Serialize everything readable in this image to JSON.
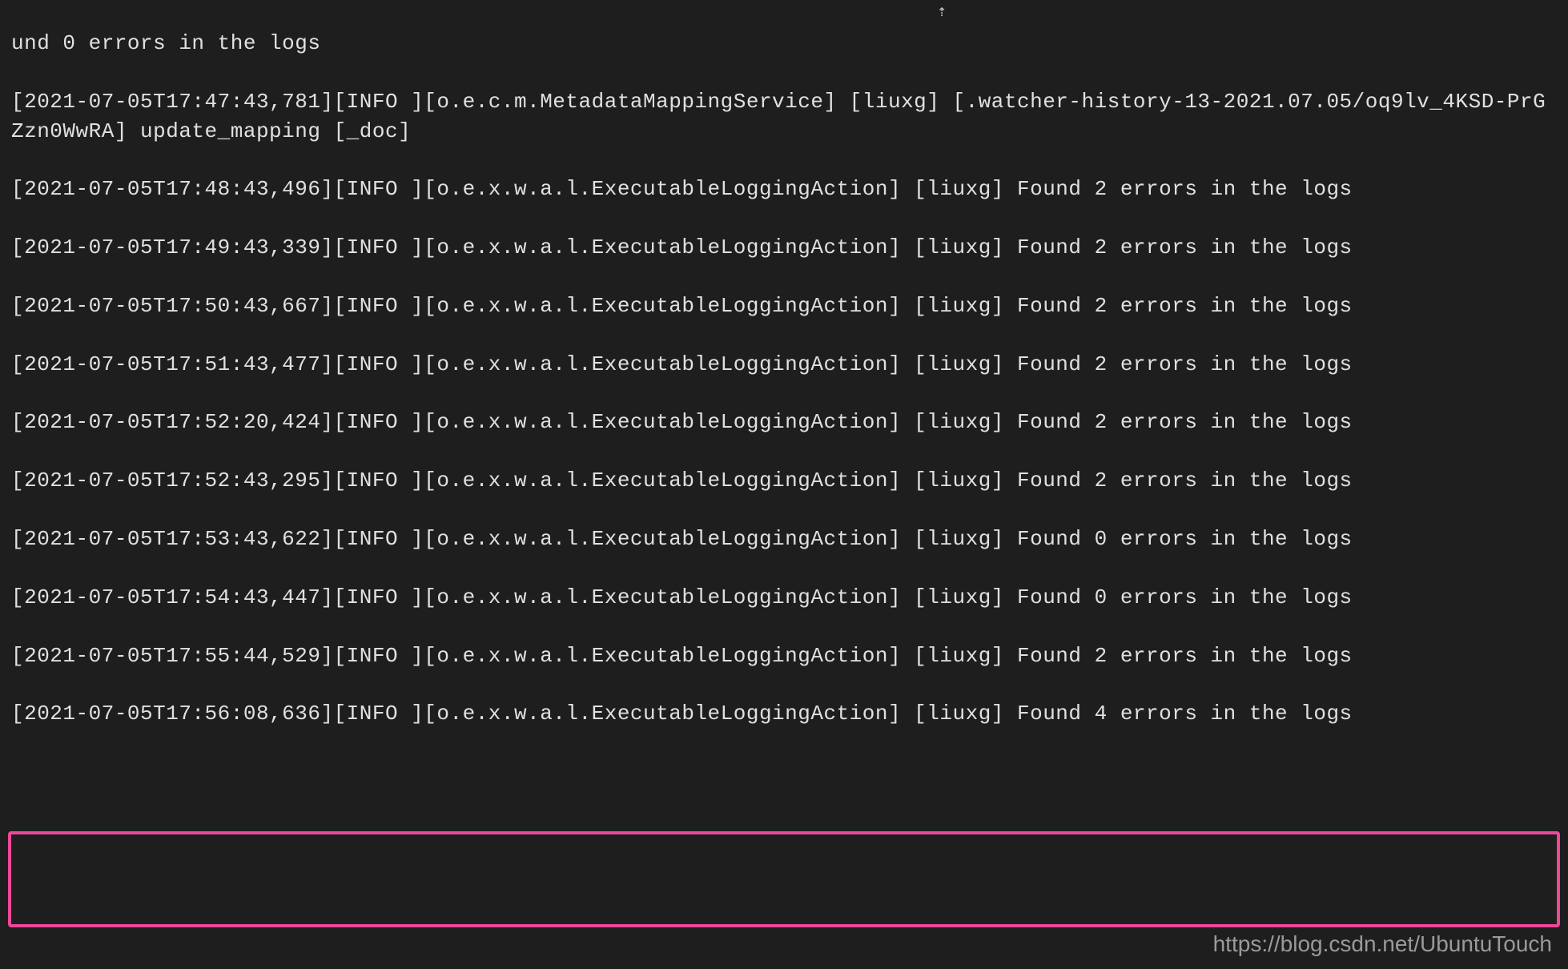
{
  "terminal": {
    "lines": [
      "und 0 errors in the logs",
      "[2021-07-05T17:47:43,781][INFO ][o.e.c.m.MetadataMappingService] [liuxg] [.watcher-history-13-2021.07.05/oq9lv_4KSD-PrGZzn0WwRA] update_mapping [_doc]",
      "[2021-07-05T17:48:43,496][INFO ][o.e.x.w.a.l.ExecutableLoggingAction] [liuxg] Found 2 errors in the logs",
      "[2021-07-05T17:49:43,339][INFO ][o.e.x.w.a.l.ExecutableLoggingAction] [liuxg] Found 2 errors in the logs",
      "[2021-07-05T17:50:43,667][INFO ][o.e.x.w.a.l.ExecutableLoggingAction] [liuxg] Found 2 errors in the logs",
      "[2021-07-05T17:51:43,477][INFO ][o.e.x.w.a.l.ExecutableLoggingAction] [liuxg] Found 2 errors in the logs",
      "[2021-07-05T17:52:20,424][INFO ][o.e.x.w.a.l.ExecutableLoggingAction] [liuxg] Found 2 errors in the logs",
      "[2021-07-05T17:52:43,295][INFO ][o.e.x.w.a.l.ExecutableLoggingAction] [liuxg] Found 2 errors in the logs",
      "[2021-07-05T17:53:43,622][INFO ][o.e.x.w.a.l.ExecutableLoggingAction] [liuxg] Found 0 errors in the logs",
      "[2021-07-05T17:54:43,447][INFO ][o.e.x.w.a.l.ExecutableLoggingAction] [liuxg] Found 0 errors in the logs",
      "[2021-07-05T17:55:44,529][INFO ][o.e.x.w.a.l.ExecutableLoggingAction] [liuxg] Found 2 errors in the logs",
      "[2021-07-05T17:56:08,636][INFO ][o.e.x.w.a.l.ExecutableLoggingAction] [liuxg] Found 4 errors in the logs"
    ]
  },
  "watermark": "https://blog.csdn.net/UbuntuTouch",
  "cursor_glyph": "⇡"
}
